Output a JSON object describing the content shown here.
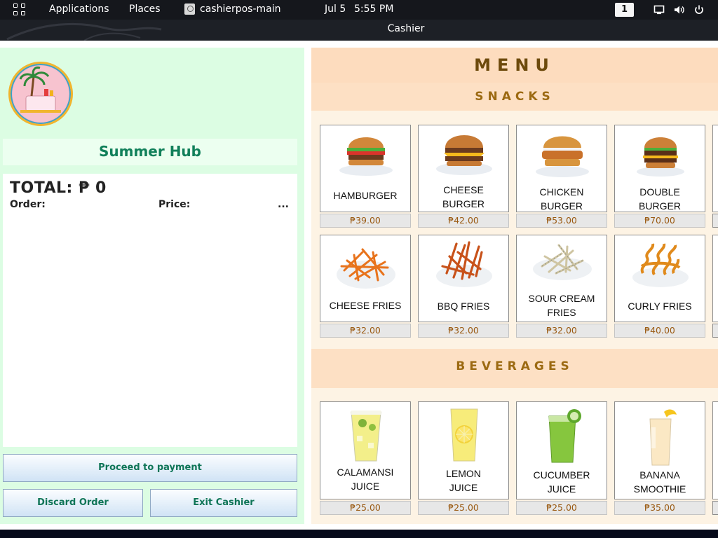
{
  "topbar": {
    "activities_icon": "app-grid-icon",
    "applications": "Applications",
    "places": "Places",
    "app_name": "cashierpos-main",
    "date": "Jul 5",
    "time": "5:55 PM",
    "workspace": "1",
    "icons": [
      "screen-icon",
      "volume-icon",
      "power-icon"
    ]
  },
  "window": {
    "title": "Cashier"
  },
  "left": {
    "logo_icon": "summer-hub-logo",
    "shop_name": "Summer Hub",
    "total_label": "TOTAL: ₱ 0",
    "order_header": "Order:",
    "price_header": "Price:",
    "more": "...",
    "buttons": {
      "proceed": "Proceed to payment",
      "discard": "Discard Order",
      "exit": "Exit Cashier"
    }
  },
  "menu": {
    "title": "MENU",
    "sections": {
      "snacks": "SNACKS",
      "beverages": "BEVERAGES"
    },
    "snacks": [
      {
        "name": "HAMBURGER",
        "price": "₱39.00"
      },
      {
        "name": "CHEESE\nBURGER",
        "price": "₱42.00"
      },
      {
        "name": "CHICKEN\nBURGER",
        "price": "₱53.00"
      },
      {
        "name": "DOUBLE\nBURGER",
        "price": "₱70.00"
      },
      {
        "name": "CHEESE FRIES",
        "price": "₱32.00"
      },
      {
        "name": "BBQ FRIES",
        "price": "₱32.00"
      },
      {
        "name": "SOUR CREAM\nFRIES",
        "price": "₱32.00"
      },
      {
        "name": "CURLY FRIES",
        "price": "₱40.00"
      }
    ],
    "beverages": [
      {
        "name": "CALAMANSI\nJUICE",
        "price": "₱25.00"
      },
      {
        "name": "LEMON\nJUICE",
        "price": "₱25.00"
      },
      {
        "name": "CUCUMBER\nJUICE",
        "price": "₱25.00"
      },
      {
        "name": "BANANA\nSMOOTHIE",
        "price": "₱35.00"
      }
    ]
  }
}
